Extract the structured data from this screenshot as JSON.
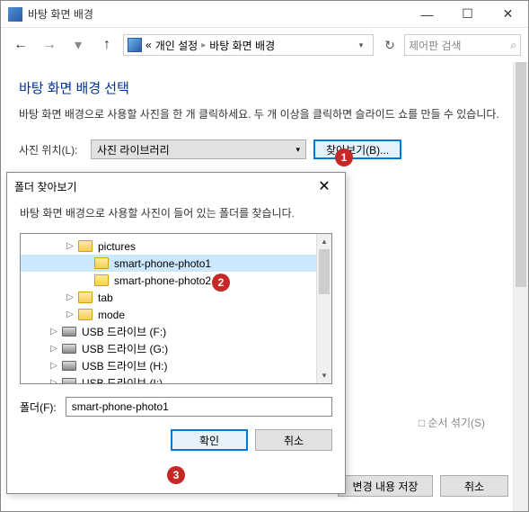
{
  "window": {
    "title": "바탕 화면 배경",
    "min": "—",
    "max": "☐",
    "close": "✕"
  },
  "nav": {
    "back": "←",
    "forward": "→",
    "up": "↑",
    "breadcrumb": {
      "prefix": "«",
      "item1": "개인 설정",
      "item2": "바탕 화면 배경"
    },
    "refresh": "↻",
    "search_placeholder": "제어판 검색",
    "search_icon": "🔍"
  },
  "main": {
    "heading": "바탕 화면 배경 선택",
    "description": "바탕 화면 배경으로 사용할 사진을 한 개 클릭하세요. 두 개 이상을 클릭하면 슬라이드 쇼를 만들 수 있습니다.",
    "location_label": "사진 위치(L):",
    "location_value": "사진 라이브러리",
    "browse_label": "찾아보기(B)...",
    "randomize_label": "□ 순서 섞기(S)",
    "save_label": "변경 내용 저장",
    "cancel_label": "취소"
  },
  "dialog": {
    "title": "폴더 찾아보기",
    "close": "✕",
    "description": "바탕 화면 배경으로 사용할 사진이 들어 있는 폴더를 찾습니다.",
    "tree": [
      {
        "indent": 1,
        "expander": "▷",
        "icon": "folder",
        "label": "pictures"
      },
      {
        "indent": 2,
        "expander": "",
        "icon": "folder",
        "label": "smart-phone-photo1",
        "selected": true
      },
      {
        "indent": 2,
        "expander": "",
        "icon": "folder",
        "label": "smart-phone-photo2"
      },
      {
        "indent": 1,
        "expander": "▷",
        "icon": "folder",
        "label": "tab"
      },
      {
        "indent": 1,
        "expander": "▷",
        "icon": "folder",
        "label": "mode"
      },
      {
        "indent": 0,
        "expander": "▷",
        "icon": "drive",
        "label": "USB 드라이브 (F:)"
      },
      {
        "indent": 0,
        "expander": "▷",
        "icon": "drive",
        "label": "USB 드라이브 (G:)"
      },
      {
        "indent": 0,
        "expander": "▷",
        "icon": "drive",
        "label": "USB 드라이브 (H:)"
      },
      {
        "indent": 0,
        "expander": "▷",
        "icon": "drive",
        "label": "USB 드라이브 (I:)"
      }
    ],
    "folder_label": "폴더(F):",
    "folder_value": "smart-phone-photo1",
    "ok_label": "확인",
    "cancel_label": "취소"
  },
  "badges": {
    "b1": "1",
    "b2": "2",
    "b3": "3"
  }
}
